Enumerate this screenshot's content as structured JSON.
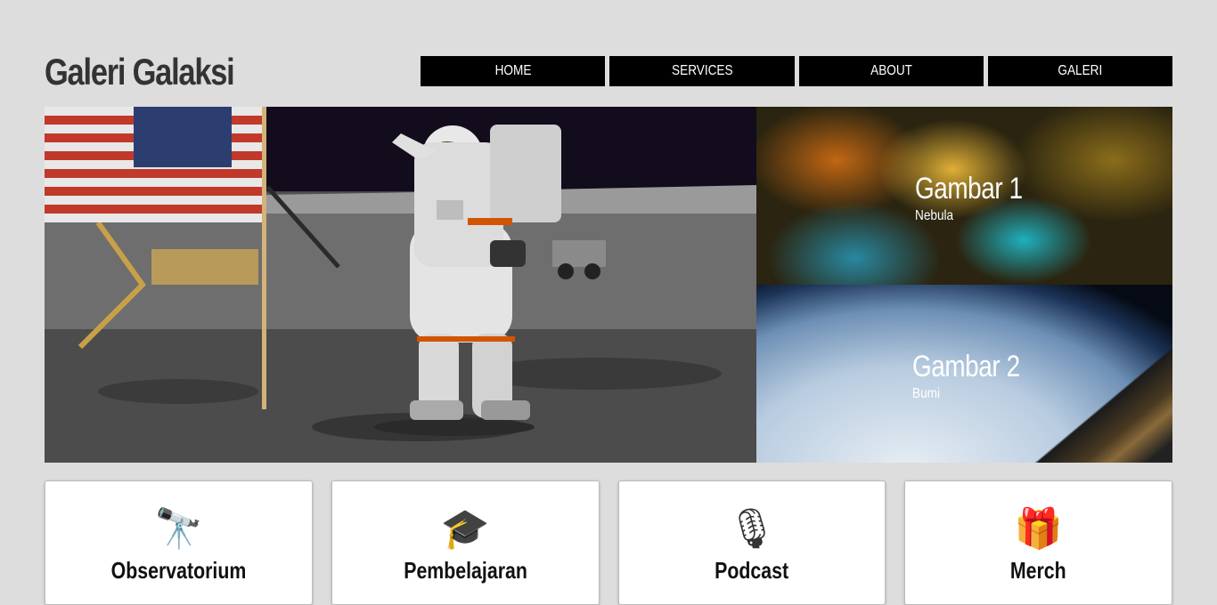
{
  "site": {
    "title": "Galeri Galaksi"
  },
  "nav": {
    "items": [
      {
        "label": "HOME"
      },
      {
        "label": "SERVICES"
      },
      {
        "label": "ABOUT"
      },
      {
        "label": "GALERI"
      }
    ]
  },
  "hero": {
    "side": [
      {
        "title": "Gambar 1",
        "subtitle": "Nebula"
      },
      {
        "title": "Gambar 2",
        "subtitle": "Bumi"
      }
    ]
  },
  "cards": [
    {
      "icon": "telescope-icon",
      "glyph": "🔭",
      "title": "Observatorium"
    },
    {
      "icon": "graduation-cap-icon",
      "glyph": "🎓",
      "title": "Pembelajaran"
    },
    {
      "icon": "microphone-icon",
      "glyph": "🎙",
      "title": "Podcast"
    },
    {
      "icon": "gift-icon",
      "glyph": "🎁",
      "title": "Merch"
    }
  ]
}
